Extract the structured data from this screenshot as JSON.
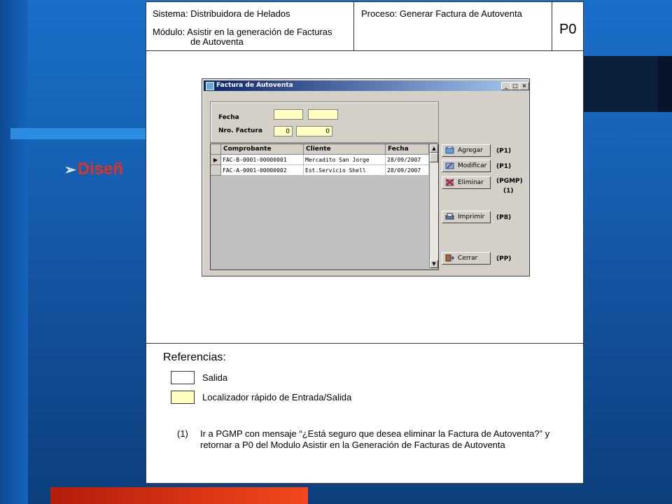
{
  "slide": {
    "title": "Diseñ",
    "arrow": "➢"
  },
  "header": {
    "system": "Sistema: Distribuidora de Helados",
    "module_line1": "Módulo: Asistir en la generación de Facturas",
    "module_line2": "de Autoventa",
    "process": "Proceso: Generar Factura de Autoventa",
    "code": "P0"
  },
  "window": {
    "title": "Factura de Autoventa",
    "minimize": "_",
    "maximize": "□",
    "close": "×",
    "fecha_label": "Fecha",
    "nro_label": "Nro. Factura",
    "nro_prefix": "0",
    "nro_number": "0"
  },
  "table": {
    "columns": [
      "Comprobante",
      "Cliente",
      "Fecha"
    ],
    "rows": [
      [
        "FAC-B-0001-00000001",
        "Mercadito San Jorge",
        "28/09/2007"
      ],
      [
        "FAC-A-0001-00000002",
        "Est.Servicio Shell",
        "28/09/2007"
      ]
    ]
  },
  "buttons": [
    {
      "label": "Agregar",
      "tag": "(P1)",
      "icon": "add-icon"
    },
    {
      "label": "Modificar",
      "tag": "(P1)",
      "icon": "edit-icon"
    },
    {
      "label": "Eliminar",
      "tag": "(PGMP)",
      "tag2": "(1)",
      "icon": "delete-icon"
    },
    {
      "label": "Imprimir",
      "tag": "(P8)",
      "icon": "printer-icon"
    },
    {
      "label": "Cerrar",
      "tag": "(PP)",
      "icon": "exit-icon"
    }
  ],
  "references": {
    "title": "Referencias:",
    "items": [
      {
        "label": "Salida",
        "color": "#ffffff"
      },
      {
        "label": "Localizador rápido de Entrada/Salida",
        "color": "#ffffc0"
      }
    ],
    "note_number": "(1)",
    "note_text": "Ir a PGMP con mensaje “¿Está seguro que desea eliminar la Factura de Autoventa?” y retornar a P0 del Modulo Asistir en la Generación de Facturas de Autoventa"
  }
}
